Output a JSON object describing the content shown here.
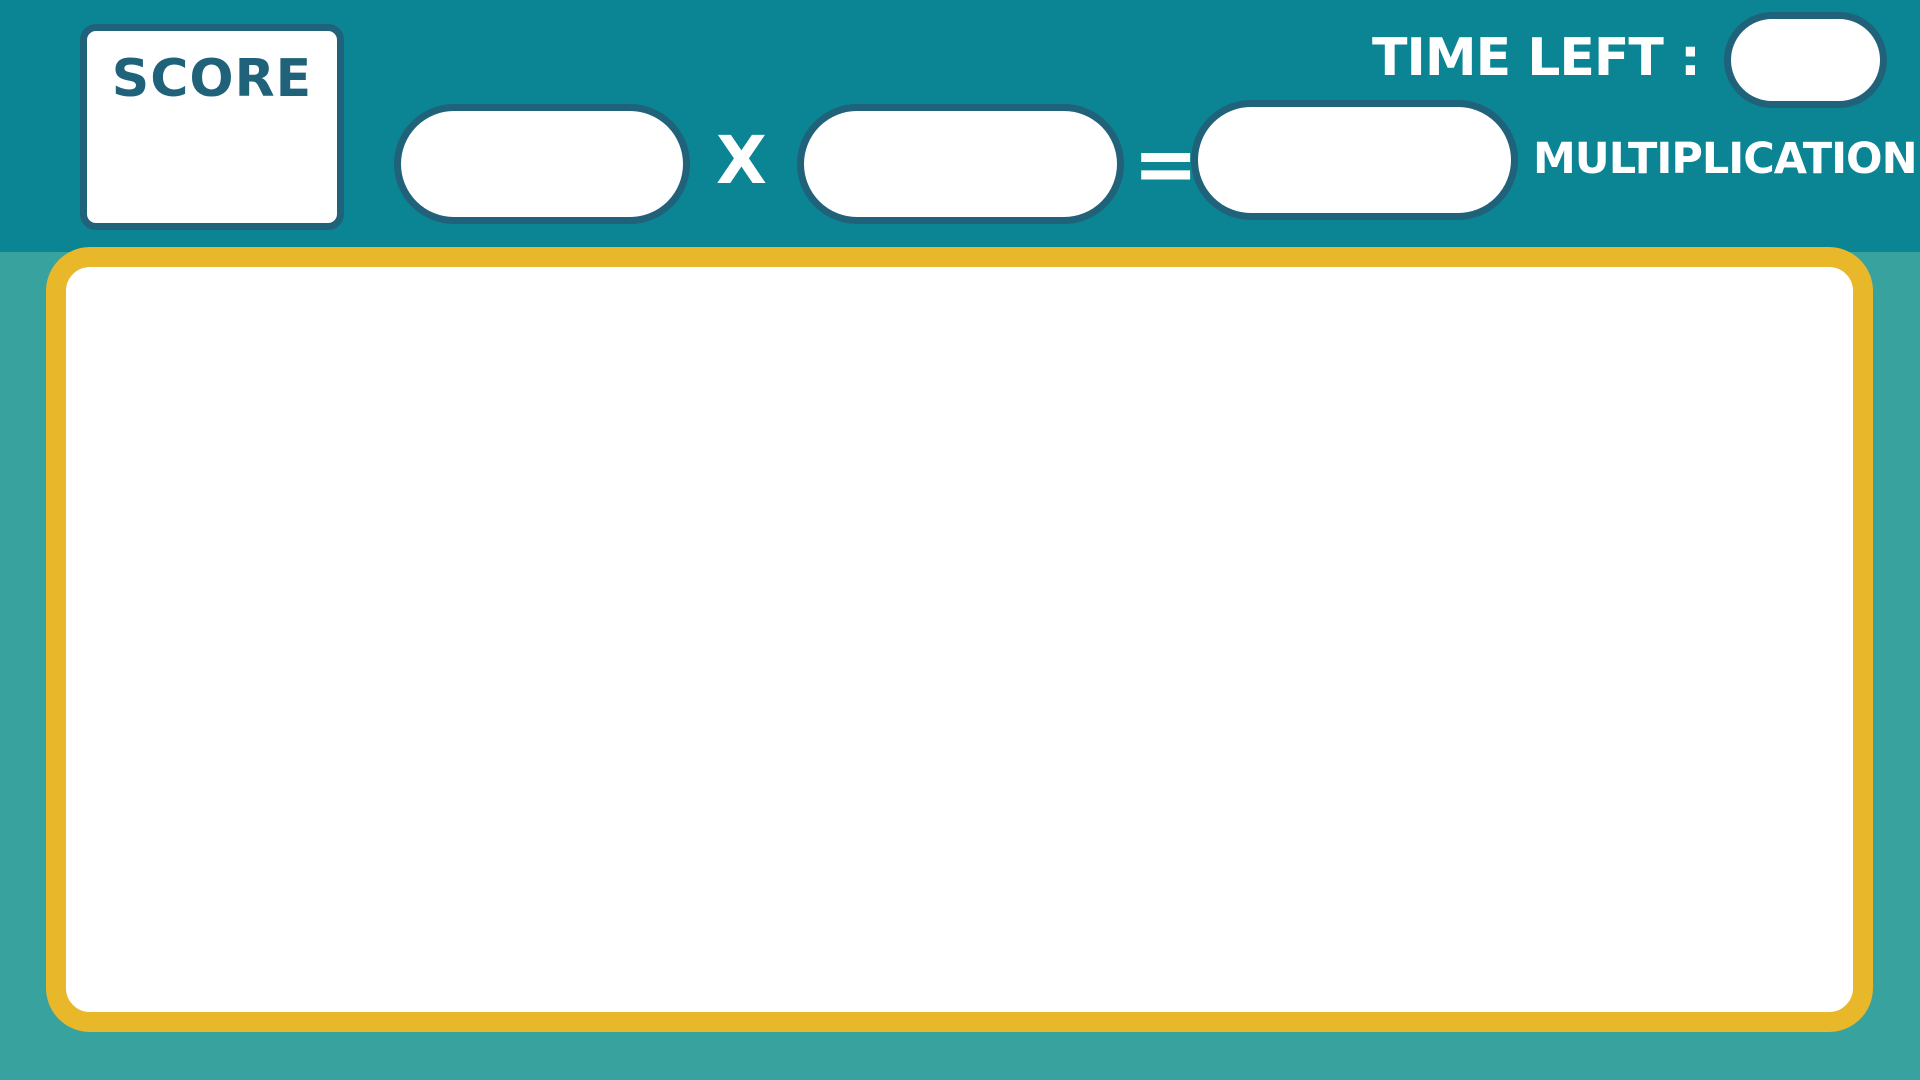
{
  "colors": {
    "header_bg": "#0b8494",
    "page_bg": "#37a29e",
    "accent_frame": "#e9b72a",
    "box_border": "#1f627a",
    "box_fill": "#ffffff",
    "label_text": "#ffffff",
    "score_text": "#1f627a"
  },
  "header": {
    "score_label": "SCORE",
    "score_value": "",
    "equation": {
      "operand_a": "",
      "operator": "X",
      "operand_b": "",
      "equals_sign": "=",
      "answer": ""
    },
    "timer": {
      "label": "TIME LEFT :",
      "value": ""
    },
    "mode_label": "MULTIPLICATION"
  },
  "play_area": {
    "content": ""
  }
}
